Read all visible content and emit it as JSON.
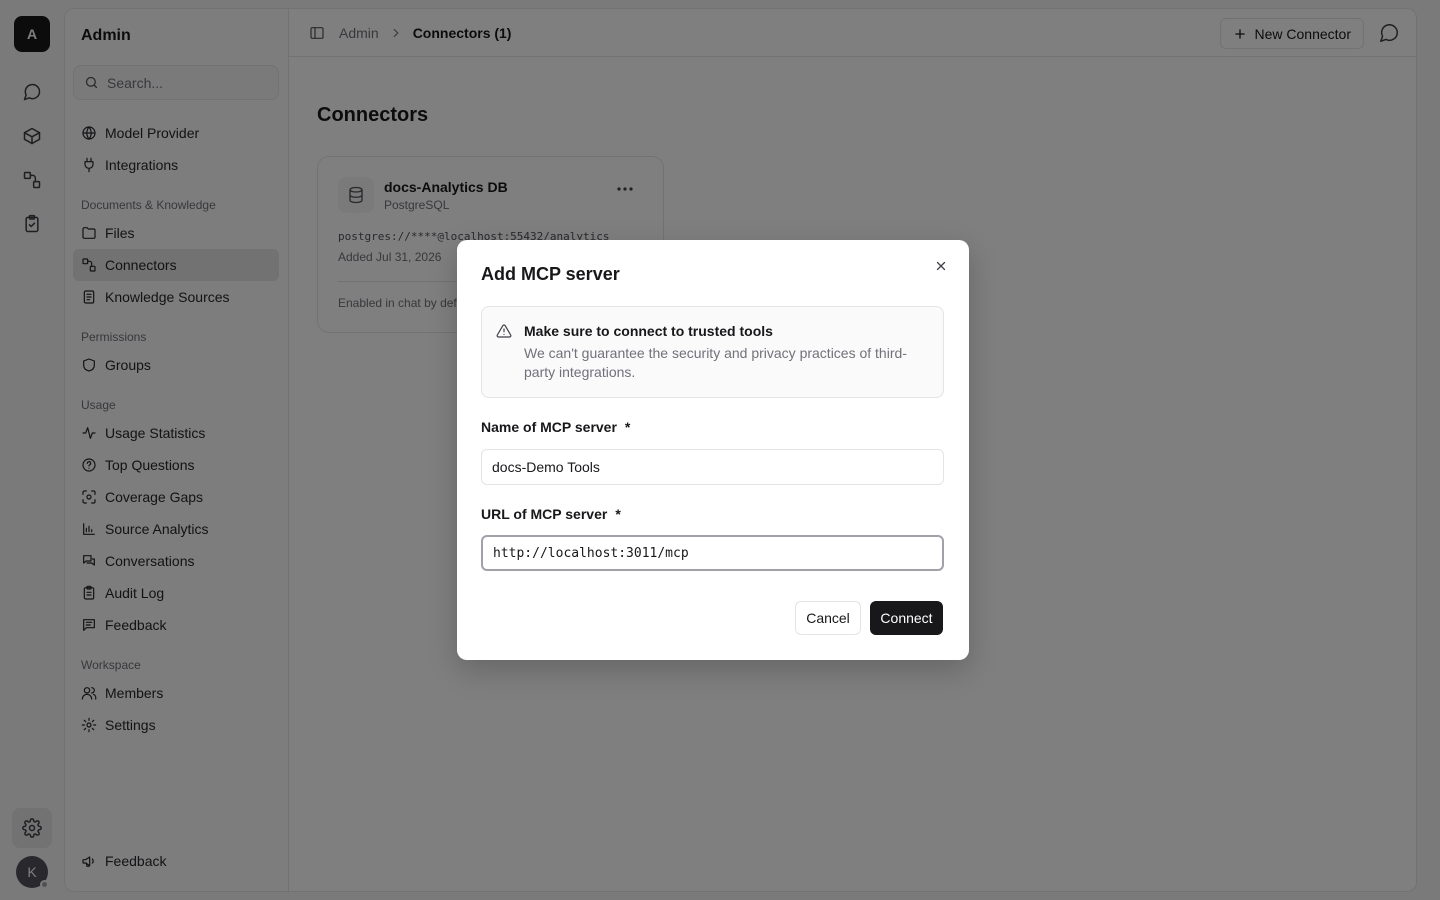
{
  "rail": {
    "workspace_initial": "A",
    "avatar_initial": "K"
  },
  "sidebar": {
    "title": "Admin",
    "search_placeholder": "Search...",
    "top_items": [
      {
        "label": "Model Provider",
        "icon": "globe-icon"
      },
      {
        "label": "Integrations",
        "icon": "plug-icon"
      }
    ],
    "sections": [
      {
        "title": "Documents & Knowledge",
        "items": [
          {
            "label": "Files",
            "icon": "folder-icon"
          },
          {
            "label": "Connectors",
            "icon": "connectors-icon",
            "active": true
          },
          {
            "label": "Knowledge Sources",
            "icon": "book-icon"
          }
        ]
      },
      {
        "title": "Permissions",
        "items": [
          {
            "label": "Groups",
            "icon": "shield-icon"
          }
        ]
      },
      {
        "title": "Usage",
        "items": [
          {
            "label": "Usage Statistics",
            "icon": "activity-icon"
          },
          {
            "label": "Top Questions",
            "icon": "question-icon"
          },
          {
            "label": "Coverage Gaps",
            "icon": "scan-icon"
          },
          {
            "label": "Source Analytics",
            "icon": "bar-chart-icon"
          },
          {
            "label": "Conversations",
            "icon": "messages-icon"
          },
          {
            "label": "Audit Log",
            "icon": "clipboard-icon"
          },
          {
            "label": "Feedback",
            "icon": "message-square-icon"
          }
        ]
      },
      {
        "title": "Workspace",
        "items": [
          {
            "label": "Members",
            "icon": "users-icon"
          },
          {
            "label": "Settings",
            "icon": "gear-icon"
          }
        ]
      }
    ],
    "bottom_item": {
      "label": "Feedback",
      "icon": "megaphone-icon"
    }
  },
  "topbar": {
    "breadcrumb_root": "Admin",
    "breadcrumb_current": "Connectors (1)",
    "new_button_label": "New Connector"
  },
  "main": {
    "page_title": "Connectors",
    "card": {
      "name": "docs-Analytics DB",
      "type": "PostgreSQL",
      "connection": "postgres://****@localhost:55432/analytics",
      "added": "Added Jul 31, 2026",
      "footer": "Enabled in chat by default"
    }
  },
  "modal": {
    "title": "Add MCP server",
    "alert_title": "Make sure to connect to trusted tools",
    "alert_description": "We can't guarantee the security and privacy practices of third-party integrations.",
    "name_label": "Name of MCP server",
    "name_value": "docs-Demo Tools",
    "url_label": "URL of MCP server",
    "url_value": "http://localhost:3011/mcp",
    "required_mark": "*",
    "cancel_label": "Cancel",
    "connect_label": "Connect"
  }
}
